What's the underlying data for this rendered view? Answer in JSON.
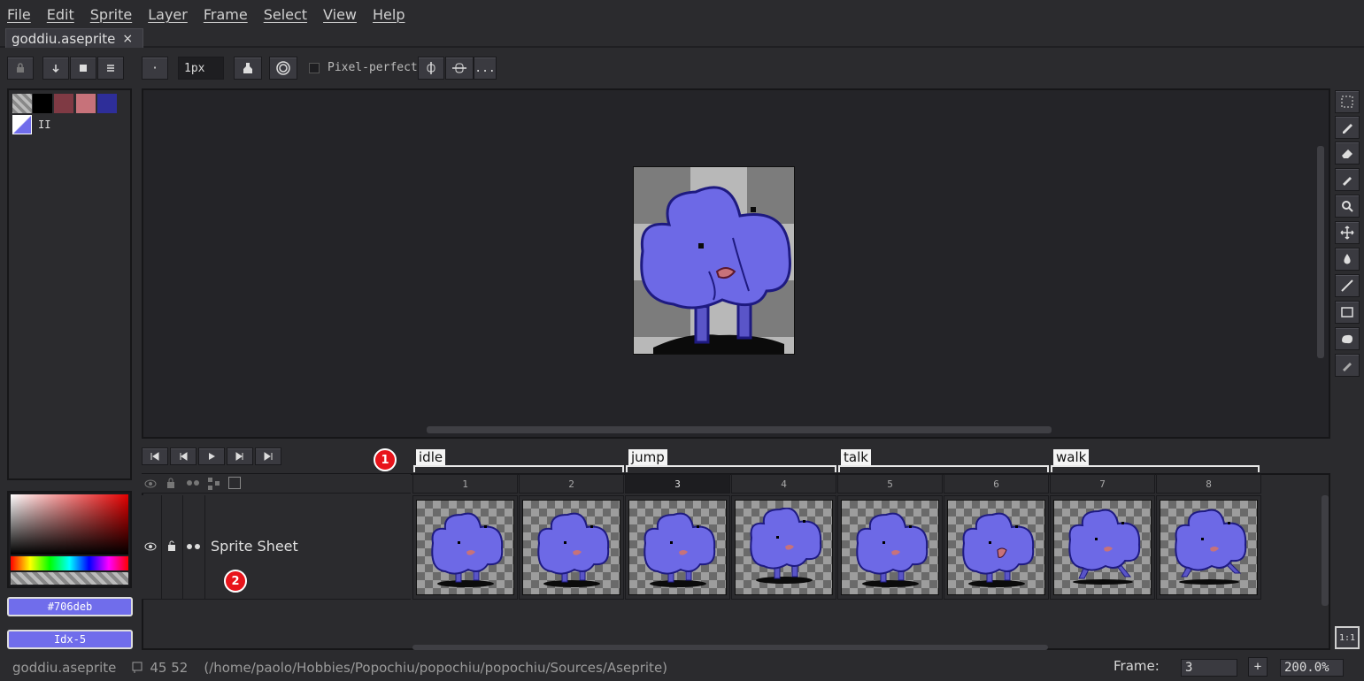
{
  "menu": [
    "File",
    "Edit",
    "Sprite",
    "Layer",
    "Frame",
    "Select",
    "View",
    "Help"
  ],
  "tab": {
    "title": "goddiu.aseprite",
    "close": "×"
  },
  "context_bar": {
    "brush_size": "1px",
    "dot": "·",
    "pixel_perfect": "Pixel-perfect",
    "more": "..."
  },
  "palette": {
    "colors": [
      "#000000",
      "#7f3a44",
      "#c7727a",
      "#2e2e99"
    ],
    "index_label": "II"
  },
  "color": {
    "hex": "#706deb",
    "index": "Idx-5",
    "fg": "#706deb"
  },
  "timeline": {
    "layer_name": "Sprite Sheet",
    "tags": [
      {
        "name": "idle"
      },
      {
        "name": "jump"
      },
      {
        "name": "talk"
      },
      {
        "name": "walk"
      }
    ],
    "frames": [
      "1",
      "2",
      "3",
      "4",
      "5",
      "6",
      "7",
      "8"
    ],
    "current_frame": "3"
  },
  "markers": [
    "1",
    "2"
  ],
  "status": {
    "file": "goddiu.aseprite",
    "size": "45 52",
    "path": "(/home/paolo/Hobbies/Popochiu/popochiu/popochiu/Sources/Aseprite)",
    "frame_label": "Frame:",
    "frame_value": "3",
    "add": "+",
    "zoom": "200.0%"
  },
  "zoom_reset": "1:1"
}
